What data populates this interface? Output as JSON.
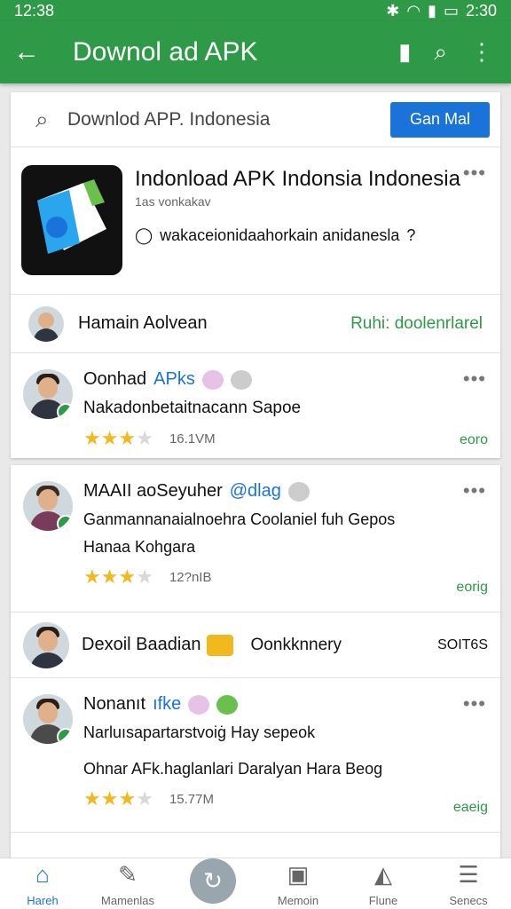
{
  "status": {
    "time": "12:38",
    "clock": "2:30"
  },
  "appbar": {
    "title": "Downol ad APK"
  },
  "search": {
    "query": "Downlod APP. Indonesia",
    "button": "Gan Mal"
  },
  "app": {
    "name": "Indonload APK Indonsia Indonesia",
    "sub": "1as vonkakav",
    "desc": "wakaceionidaahorkain anidanesla"
  },
  "author": {
    "name": "Hamain Aolvean",
    "link": "Ruhi: doolenrlarel"
  },
  "reviews": [
    {
      "name": "Oonhad",
      "name_hl": "APks",
      "text": "Nakadonbetaitnacann Sapoe",
      "count": "16.1VM",
      "right": "eoro"
    },
    {
      "name": "MAAII aoSeyuher",
      "name_hl": "@dlag",
      "text": "Ganmannanaialnoehra Coolaniel fuh Gepos",
      "text2": "Hanaa Kohgara",
      "count": "12?nIB",
      "right": "eorig"
    },
    {
      "name": "Dexoil Baadian",
      "mid": "Oonkknnery",
      "right": "SOIT6S"
    },
    {
      "name": "Nonanıt",
      "name_hl": "ıfke",
      "text": "Narluısapartarstvoiġ Hay sepeok",
      "text2": "Ohnar AFk.haglanlari Daralyan Hara Beog",
      "count": "15.77M",
      "right": "eaeig"
    }
  ],
  "nav": [
    "Hareh",
    "Mamenlas",
    "",
    "Memoin",
    "Flune",
    "Senecs"
  ]
}
